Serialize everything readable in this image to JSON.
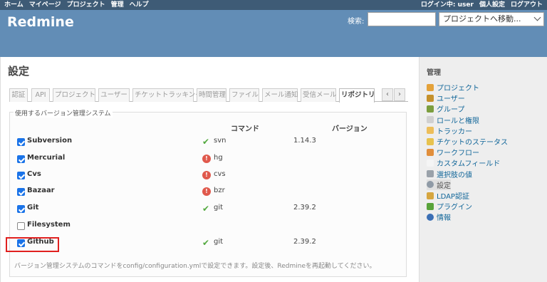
{
  "topmenu": {
    "left": [
      "ホーム",
      "マイページ",
      "プロジェクト",
      "管理",
      "ヘルプ"
    ],
    "logged_in": "ログイン中: user",
    "my_account": "個人設定",
    "logout": "ログアウト"
  },
  "header": {
    "app_title": "Redmine",
    "search_label": "検索:",
    "search_value": "",
    "project_jump": "プロジェクトへ移動..."
  },
  "page": {
    "title": "設定"
  },
  "tabs": [
    {
      "label": "認証"
    },
    {
      "label": "API"
    },
    {
      "label": "プロジェクト"
    },
    {
      "label": "ユーザー"
    },
    {
      "label": "チケットトラッキング"
    },
    {
      "label": "時間管理"
    },
    {
      "label": "ファイル"
    },
    {
      "label": "メール通知"
    },
    {
      "label": "受信メール"
    },
    {
      "label": "リポジトリ",
      "active": true
    }
  ],
  "tab_scroll": {
    "prev": "‹",
    "next": "›"
  },
  "scm": {
    "legend": "使用するバージョン管理システム",
    "col_command": "コマンド",
    "col_version": "バージョン",
    "rows": [
      {
        "name": "Subversion",
        "checked": true,
        "status": "ok",
        "command": "svn",
        "version": "1.14.3"
      },
      {
        "name": "Mercurial",
        "checked": true,
        "status": "error",
        "command": "hg",
        "version": ""
      },
      {
        "name": "Cvs",
        "checked": true,
        "status": "error",
        "command": "cvs",
        "version": ""
      },
      {
        "name": "Bazaar",
        "checked": true,
        "status": "error",
        "command": "bzr",
        "version": ""
      },
      {
        "name": "Git",
        "checked": true,
        "status": "ok",
        "command": "git",
        "version": "2.39.2"
      },
      {
        "name": "Filesystem",
        "checked": false,
        "status": "",
        "command": "",
        "version": ""
      },
      {
        "name": "Github",
        "checked": true,
        "status": "ok",
        "command": "git",
        "version": "2.39.2"
      }
    ],
    "hint": "バージョン管理システムのコマンドをconfig/configuration.ymlで設定できます。設定後、Redmineを再起動してください。"
  },
  "sidebar": {
    "title": "管理",
    "items": [
      {
        "label": "プロジェクト",
        "icon": "projects-icon",
        "color": "#E4A23A"
      },
      {
        "label": "ユーザー",
        "icon": "user-icon",
        "color": "#C5912C"
      },
      {
        "label": "グループ",
        "icon": "group-icon",
        "color": "#7C9E3E"
      },
      {
        "label": "ロールと権限",
        "icon": "roles-icon",
        "color": "#D0D0D0"
      },
      {
        "label": "トラッカー",
        "icon": "tracker-icon",
        "color": "#EDBE5A"
      },
      {
        "label": "チケットのステータス",
        "icon": "status-icon",
        "color": "#E7C24E"
      },
      {
        "label": "ワークフロー",
        "icon": "workflow-icon",
        "color": "#E18E3B"
      },
      {
        "label": "カスタムフィールド",
        "icon": "custom-field-icon",
        "color": "#F5F5F5"
      },
      {
        "label": "選択肢の値",
        "icon": "enumeration-icon",
        "color": "#9AA2AA"
      },
      {
        "label": "設定",
        "icon": "settings-icon",
        "color": "#8F9AA6",
        "active": true
      },
      {
        "label": "LDAP認証",
        "icon": "ldap-icon",
        "color": "#D6A640"
      },
      {
        "label": "プラグイン",
        "icon": "plugin-icon",
        "color": "#58A33A"
      },
      {
        "label": "情報",
        "icon": "info-icon",
        "color": "#3B6FB5"
      }
    ]
  }
}
